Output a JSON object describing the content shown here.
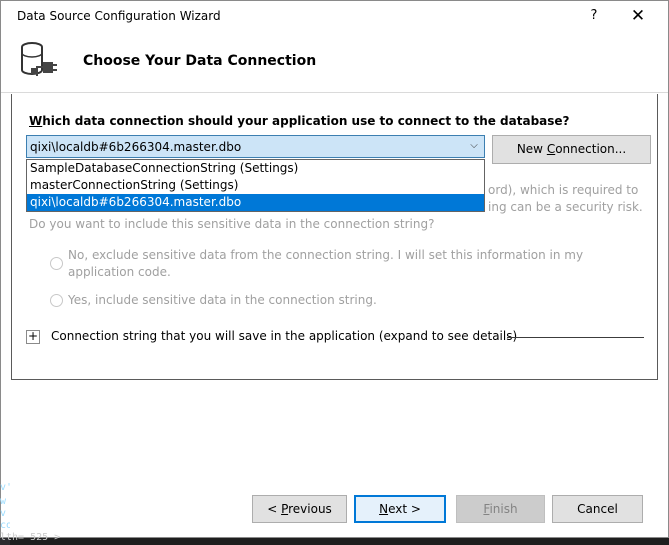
{
  "window": {
    "title": "Data Source Configuration Wizard",
    "help_glyph": "?",
    "close_glyph": "✕"
  },
  "header": {
    "title": "Choose Your Data Connection",
    "icon": "database-plug-icon"
  },
  "main": {
    "question_u": "W",
    "question_rest": "hich data connection should your application use to connect to the database?",
    "combo": {
      "selected": "qixi\\localdb#6b266304.master.dbo",
      "arrow": "⌵",
      "options": [
        "SampleDatabaseConnectionString (Settings)",
        "masterConnectionString (Settings)",
        "qixi\\localdb#6b266304.master.dbo"
      ],
      "highlighted_index": 2
    },
    "new_connection_label_pre": "New ",
    "new_connection_label_u": "C",
    "new_connection_label_post": "onnection...",
    "info": {
      "line1_tail": "ord), which is required to",
      "line2_tail": "ing can be a security risk.",
      "line3": "Do you want to include this sensitive data in the connection string?"
    },
    "radio_no_label": "No, exclude sensitive data from the connection string. I will set this information in my application code.",
    "radio_yes_label": "Yes, include sensitive data in the connection string.",
    "expander_glyph": "+",
    "expander_label": "Connection string that you will save in the application (expand to see details)"
  },
  "footer": {
    "previous_pre": "< ",
    "previous_u": "P",
    "previous_post": "revious",
    "next_u": "N",
    "next_post": "ext >",
    "finish_u": "F",
    "finish_post": "inish",
    "cancel": "Cancel"
  },
  "background": {
    "code_snippets": [
      "v'",
      "w",
      "v",
      "co",
      "lth= 525 >"
    ]
  }
}
